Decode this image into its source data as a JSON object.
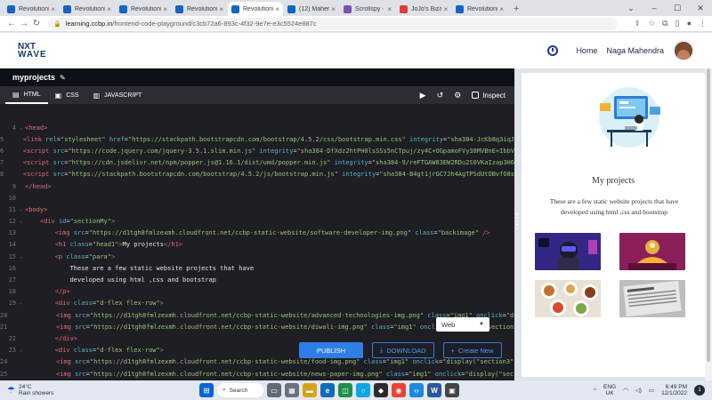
{
  "browser": {
    "tabs": [
      {
        "label": "Revolutionize",
        "color": "#1565c0",
        "active": false
      },
      {
        "label": "Revolutionize",
        "color": "#1565c0",
        "active": false
      },
      {
        "label": "Revolutionize",
        "color": "#1565c0",
        "active": false
      },
      {
        "label": "Revolutionize",
        "color": "#1565c0",
        "active": false
      },
      {
        "label": "Revolutionize",
        "color": "#1565c0",
        "active": true
      },
      {
        "label": "(12) Mahendr",
        "color": "#0a66c2",
        "active": false
      },
      {
        "label": "Scrollspy · Boo",
        "color": "#7952b3",
        "active": false
      },
      {
        "label": "JoJo's Bizarre",
        "color": "#e53935",
        "active": false
      },
      {
        "label": "Revolutionize",
        "color": "#1565c0",
        "active": false
      }
    ],
    "url_host": "learning.ccbp.in",
    "url_path": "/frontend-code-playground/c3cb72a6-893c-4f32-9e7e-e3c5524e887c"
  },
  "header": {
    "logo_line1": "NXT",
    "logo_line2": "WAVE",
    "home_label": "Home",
    "user_name": "Naga Mahendra"
  },
  "playground": {
    "project_name": "myprojects",
    "tabs": [
      {
        "label": "HTML",
        "icon": "html-icon"
      },
      {
        "label": "CSS",
        "icon": "css-icon"
      },
      {
        "label": "JAVASCRIPT",
        "icon": "js-icon"
      }
    ],
    "inspect_label": "Inspect",
    "publish_label": "PUBLISH",
    "download_label": "DOWNLOAD",
    "create_label": "Create New",
    "web_select": "Web"
  },
  "code_lines": [
    {
      "n": "4",
      "fold": "v",
      "html": "<span class='tg'>&lt;head&gt;</span>"
    },
    {
      "n": "5",
      "fold": "",
      "html": "    <span class='tg'>&lt;link</span> <span class='at'>rel</span>=<span class='st'>\"stylesheet\"</span> <span class='at'>href</span>=<span class='st'>\"https://stackpath.bootstrapcdn.com/bootstrap/4.5.2/css/bootstrap.min.css\"</span> <span class='at'>integrity</span>=<span class='st'>\"sha384-JcKb8q3iqJ</span>"
    },
    {
      "n": "6",
      "fold": "",
      "html": "    <span class='tg'>&lt;script</span> <span class='at'>src</span>=<span class='st'>\"https://code.jquery.com/jquery-3.5.1.slim.min.js\"</span> <span class='at'>integrity</span>=<span class='st'>\"sha384-DfXdz2htPH0lsSSs5nCTpuj/zy4C+OGpamoFVy38MVBnE+IbbV</span>"
    },
    {
      "n": "7",
      "fold": "",
      "html": "    <span class='tg'>&lt;script</span> <span class='at'>src</span>=<span class='st'>\"https://cdn.jsdelivr.net/npm/popper.js@1.16.1/dist/umd/popper.min.js\"</span> <span class='at'>integrity</span>=<span class='st'>\"sha384-9/reFTGAW83EW2RDu2S0VKaIzap3H6</span>"
    },
    {
      "n": "8",
      "fold": "",
      "html": "    <span class='tg'>&lt;script</span> <span class='at'>src</span>=<span class='st'>\"https://stackpath.bootstrapcdn.com/bootstrap/4.5.2/js/bootstrap.min.js\"</span> <span class='at'>integrity</span>=<span class='st'>\"sha384-B4gt1jrGC7Jh4AgTPSdUtOBvfO8s</span>"
    },
    {
      "n": "9",
      "fold": "",
      "html": "<span class='tg'>&lt;/head&gt;</span>"
    },
    {
      "n": "10",
      "fold": "",
      "html": ""
    },
    {
      "n": "11",
      "fold": "v",
      "html": "<span class='tg'>&lt;body&gt;</span>"
    },
    {
      "n": "12",
      "fold": "v",
      "html": "    <span class='tg'>&lt;div</span> <span class='at'>id</span>=<span class='st'>\"sectionMy\"</span><span class='tg'>&gt;</span>"
    },
    {
      "n": "13",
      "fold": "",
      "html": "        <span class='tg'>&lt;img</span> <span class='at'>src</span>=<span class='st'>\"https://d1tgh8fmlzexmh.cloudfront.net/ccbp-static-website/software-developer-img.png\"</span> <span class='at'>class</span>=<span class='st'>\"backimage\"</span> <span class='tg'>/&gt;</span>"
    },
    {
      "n": "14",
      "fold": "",
      "html": "        <span class='tg'>&lt;h1</span> <span class='at'>class</span>=<span class='st'>\"head1\"</span><span class='tg'>&gt;</span><span class='tx'>My projects</span><span class='tg'>&lt;/h1&gt;</span>"
    },
    {
      "n": "15",
      "fold": "v",
      "html": "        <span class='tg'>&lt;p</span> <span class='at'>class</span>=<span class='st'>\"para\"</span><span class='tg'>&gt;</span>"
    },
    {
      "n": "16",
      "fold": "",
      "html": "            <span class='tx'>These are a few static website projects that have</span>"
    },
    {
      "n": "17",
      "fold": "",
      "html": "            <span class='tx'>developed using html ,css and bootstrap</span>"
    },
    {
      "n": "18",
      "fold": "",
      "html": "        <span class='tg'>&lt;/p&gt;</span>"
    },
    {
      "n": "19",
      "fold": "v",
      "html": "        <span class='tg'>&lt;div</span> <span class='at'>class</span>=<span class='st'>\"d-flex flex-row\"</span><span class='tg'>&gt;</span>"
    },
    {
      "n": "20",
      "fold": "",
      "html": "            <span class='tg'>&lt;img</span> <span class='at'>src</span>=<span class='st'>\"https://d1tgh8fmlzexmh.cloudfront.net/ccbp-static-website/advanced-technologies-img.png\"</span> <span class='at'>class</span>=<span class='st'>\"img1\"</span> <span class='at'>onclick</span>=<span class='st'>\"di</span>"
    },
    {
      "n": "21",
      "fold": "",
      "html": "            <span class='tg'>&lt;img</span> <span class='at'>src</span>=<span class='st'>\"https://d1tgh8fmlzexmh.cloudfront.net/ccbp-static-website/diwali-img.png\"</span> <span class='at'>class</span>=<span class='st'>\"img1\"</span> <span class='at'>onclick</span>=<span class='st'>\"display(\"section2</span>"
    },
    {
      "n": "22",
      "fold": "",
      "html": "        <span class='tg'>&lt;/div&gt;</span>"
    },
    {
      "n": "23",
      "fold": "v",
      "html": "        <span class='tg'>&lt;div</span> <span class='at'>class</span>=<span class='st'>\"d-flex flex-row\"</span><span class='tg'>&gt;</span>"
    },
    {
      "n": "24",
      "fold": "",
      "html": "            <span class='tg'>&lt;img</span> <span class='at'>src</span>=<span class='st'>\"https://d1tgh8fmlzexmh.cloudfront.net/ccbp-static-website/food-img.png\"</span> <span class='at'>class</span>=<span class='st'>\"img1\"</span> <span class='at'>onclick</span>=<span class='st'>\"display(\"section3\")</span>"
    },
    {
      "n": "25",
      "fold": "",
      "html": "            <span class='tg'>&lt;img</span> <span class='at'>src</span>=<span class='st'>\"https://d1tgh8fmlzexmh.cloudfront.net/ccbp-static-website/news-paper-img.png\"</span> <span class='at'>class</span>=<span class='st'>\"img1\"</span> <span class='at'>onclick</span>=<span class='st'>\"display(\"sect</span>"
    }
  ],
  "preview": {
    "title": "My projects",
    "para": "These are a few static website projects that have developed using html ,css and bootstrap"
  },
  "taskbar": {
    "temp": "24°C",
    "weather": "Rain showers",
    "search_label": "Search",
    "lang1": "ENG",
    "lang2": "UK",
    "time": "6:49 PM",
    "date": "12/1/2022",
    "notif_count": "1"
  }
}
